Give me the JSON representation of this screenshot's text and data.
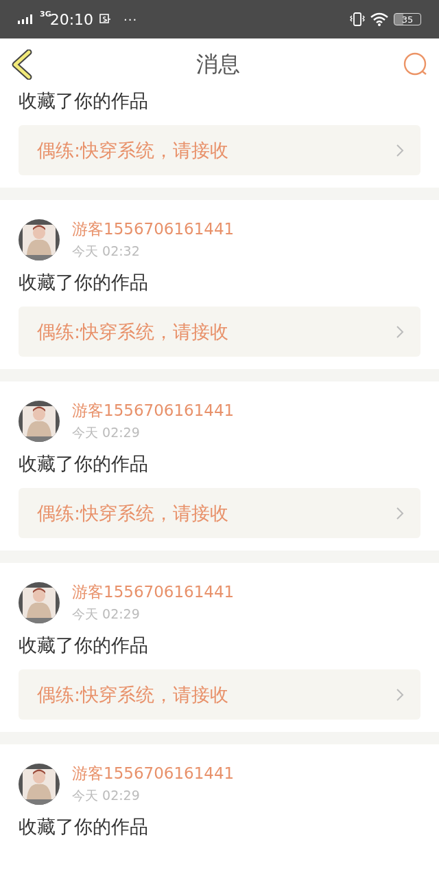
{
  "status_bar": {
    "network": "3G",
    "time": "20:10",
    "more": "···",
    "battery": "35"
  },
  "nav": {
    "title": "消息"
  },
  "messages": [
    {
      "action": "收藏了你的作品",
      "work": "偶练:快穿系统，请接收"
    },
    {
      "user": "游客1556706161441",
      "time": "今天 02:32",
      "action": "收藏了你的作品",
      "work": "偶练:快穿系统，请接收"
    },
    {
      "user": "游客1556706161441",
      "time": "今天 02:29",
      "action": "收藏了你的作品",
      "work": "偶练:快穿系统，请接收"
    },
    {
      "user": "游客1556706161441",
      "time": "今天 02:29",
      "action": "收藏了你的作品",
      "work": "偶练:快穿系统，请接收"
    },
    {
      "user": "游客1556706161441",
      "time": "今天 02:29",
      "action": "收藏了你的作品"
    }
  ]
}
